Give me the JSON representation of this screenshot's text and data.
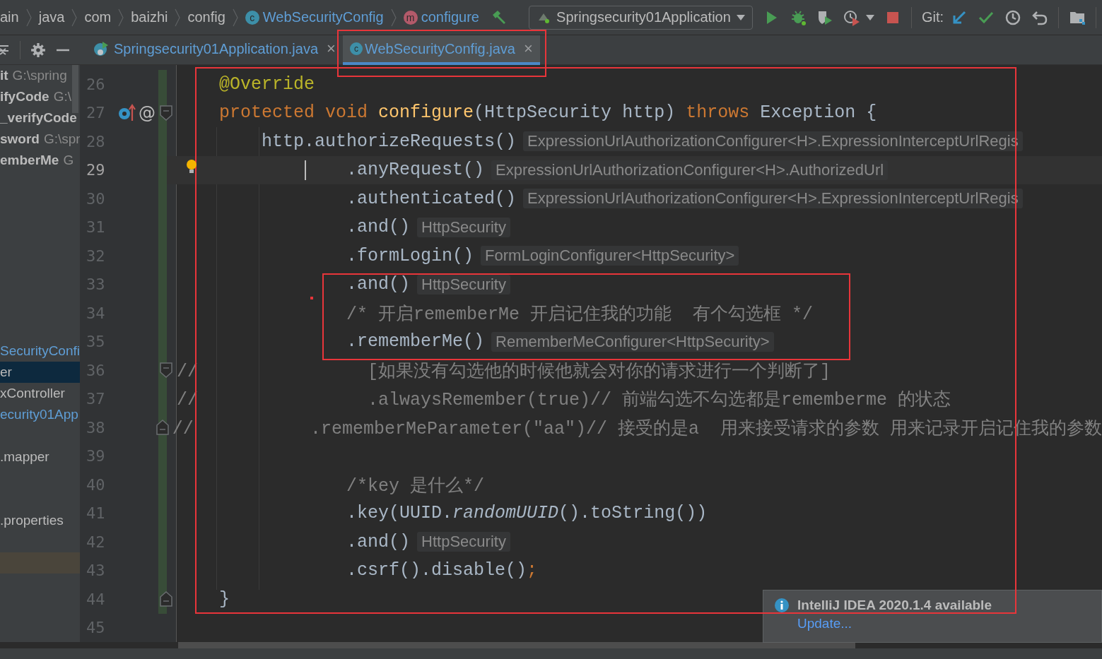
{
  "breadcrumbs": [
    {
      "label": "ain"
    },
    {
      "label": "java"
    },
    {
      "label": "com"
    },
    {
      "label": "baizhi"
    },
    {
      "label": "config"
    },
    {
      "label": "WebSecurityConfig",
      "kind": "class",
      "icon_letter": "c"
    },
    {
      "label": "configure",
      "kind": "method",
      "icon_letter": "m"
    }
  ],
  "run_config": {
    "label": "Springsecurity01Application"
  },
  "git_label": "Git:",
  "tabs": [
    {
      "label": "Springsecurity01Application.java",
      "kind": "app",
      "selected": false,
      "close": "×"
    },
    {
      "label": "WebSecurityConfig.java",
      "kind": "class",
      "icon_letter": "c",
      "selected": true,
      "close": "×"
    }
  ],
  "project_tree": [
    {
      "name": "it",
      "path": "G:\\spring",
      "kind": "module",
      "selected": false
    },
    {
      "name": "ifyCode",
      "path": "G:\\",
      "kind": "module",
      "selected": false
    },
    {
      "name": "_verifyCode",
      "kind": "module",
      "selected": false
    },
    {
      "name": "sword",
      "path": "G:\\spr",
      "kind": "module",
      "selected": false
    },
    {
      "name": "emberMe",
      "path": "G",
      "kind": "module",
      "selected": false
    },
    {
      "name": "SecurityConfi",
      "kind": "class",
      "selected": false
    },
    {
      "name": "er",
      "kind": "file",
      "selected": true
    },
    {
      "name": "xController",
      "kind": "file",
      "selected": false
    },
    {
      "name": "ecurity01App",
      "kind": "class",
      "selected": false
    },
    {
      "name": ".mapper",
      "kind": "file",
      "selected": false
    },
    {
      "name": ".properties",
      "kind": "file",
      "selected": false
    }
  ],
  "editor": {
    "lines": [
      {
        "number": "26",
        "current": false,
        "code": [
          {
            "t": "    @Override",
            "kind": "annotation"
          }
        ]
      },
      {
        "number": "27",
        "current": false,
        "override_icon": true,
        "gutter_text": "@",
        "fold_start": true,
        "code": [
          {
            "t": "    protected",
            "kind": "keyword"
          },
          {
            "t": " void",
            "kind": "keyword"
          },
          {
            "t": " configure",
            "kind": "method"
          },
          {
            "t": "(HttpSecurity http) ",
            "kind": "plain"
          },
          {
            "t": "throws",
            "kind": "keyword"
          },
          {
            "t": " Exception {",
            "kind": "plain"
          }
        ]
      },
      {
        "number": "28",
        "current": false,
        "code": [
          {
            "t": "        http.authorizeRequests()",
            "kind": "plain"
          }
        ],
        "hint": "ExpressionUrlAuthorizationConfigurer<H>.ExpressionInterceptUrlRegis"
      },
      {
        "number": "29",
        "current": true,
        "bulb": true,
        "caret": true,
        "code": [
          {
            "t": "                .anyRequest()",
            "kind": "plain"
          }
        ],
        "hint": "ExpressionUrlAuthorizationConfigurer<H>.AuthorizedUrl"
      },
      {
        "number": "30",
        "current": false,
        "code": [
          {
            "t": "                .authenticated()",
            "kind": "plain"
          }
        ],
        "hint": "ExpressionUrlAuthorizationConfigurer<H>.ExpressionInterceptUrlRegis"
      },
      {
        "number": "31",
        "current": false,
        "code": [
          {
            "t": "                .and()",
            "kind": "plain"
          }
        ],
        "hint": "HttpSecurity"
      },
      {
        "number": "32",
        "current": false,
        "code": [
          {
            "t": "                .formLogin()",
            "kind": "plain"
          }
        ],
        "hint": "FormLoginConfigurer<HttpSecurity>"
      },
      {
        "number": "33",
        "current": false,
        "code": [
          {
            "t": "                .and()",
            "kind": "plain"
          }
        ],
        "hint": "HttpSecurity"
      },
      {
        "number": "34",
        "current": false,
        "code": [
          {
            "t": "                /* 开启rememberMe 开启记住我的功能  有个勾选框 */",
            "kind": "comment"
          }
        ]
      },
      {
        "number": "35",
        "current": false,
        "code": [
          {
            "t": "                .rememberMe()",
            "kind": "plain"
          }
        ],
        "hint": "RememberMeConfigurer<HttpSecurity>"
      },
      {
        "number": "36",
        "current": false,
        "fold_start": true,
        "code": [
          {
            "t": "//                [如果没有勾选他的时候他就会对你的请求进行一个判断了]",
            "kind": "comment"
          }
        ]
      },
      {
        "number": "37",
        "current": false,
        "code": [
          {
            "t": "//                .alwaysRemember(true)// 前端勾选不勾选都是rememberme 的状态",
            "kind": "comment"
          }
        ]
      },
      {
        "number": "38",
        "current": false,
        "fold_end": true,
        "code": [
          {
            "t": "//           .rememberMeParameter(\"aa\")// 接受的是a  用来接受请求的参数 用来记录开启记住我的参数",
            "kind": "comment"
          }
        ]
      },
      {
        "number": "39",
        "current": false
      },
      {
        "number": "40",
        "current": false,
        "code": [
          {
            "t": "                /*key 是什么*/",
            "kind": "comment"
          }
        ]
      },
      {
        "number": "41",
        "current": false,
        "code": [
          {
            "t": "                .key(UUID.",
            "kind": "plain"
          },
          {
            "t": "randomUUID",
            "kind": "static"
          },
          {
            "t": "().toString())",
            "kind": "plain"
          }
        ]
      },
      {
        "number": "42",
        "current": false,
        "code": [
          {
            "t": "                .and()",
            "kind": "plain"
          }
        ],
        "hint": "HttpSecurity"
      },
      {
        "number": "43",
        "current": false,
        "code": [
          {
            "t": "                .csrf().disable()",
            "kind": "plain"
          },
          {
            "t": ";",
            "kind": "keyword"
          }
        ]
      },
      {
        "number": "44",
        "current": false,
        "fold_end": true,
        "code": [
          {
            "t": "    }",
            "kind": "plain"
          }
        ]
      },
      {
        "number": "45",
        "current": false
      }
    ]
  },
  "notification": {
    "title": "IntelliJ IDEA 2020.1.4 available",
    "link": "Update..."
  }
}
